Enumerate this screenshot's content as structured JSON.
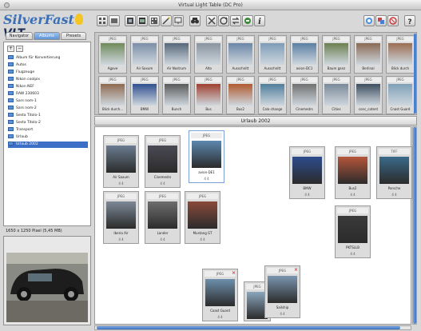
{
  "window": {
    "title": "Virtual Light Table (DC Pro)"
  },
  "logo": {
    "silver": "SilverFast",
    "vlt": "VLT"
  },
  "toolbar": {
    "left": [
      "grid-view-icon",
      "preview-icon",
      "film-icon",
      "filmstrip-icon",
      "contact-sheet-icon",
      "magic-wand-icon",
      "display-icon",
      "binoculars-icon",
      "delete-icon",
      "rotate-icon",
      "transfer-icon",
      "export-icon",
      "info-icon"
    ],
    "right": [
      "scan-icon",
      "convert-icon",
      "close-circle-icon",
      "help-icon"
    ],
    "info_label": "i",
    "help_label": "?"
  },
  "tabs": [
    "Navigator",
    "Albums",
    "Presets"
  ],
  "tree": {
    "items": [
      "Album für Konvertierung",
      "Autos",
      "Flugzeuge",
      "Nikon coolpix",
      "Nikon NEF",
      "RAW 230603",
      "Sars nom-1",
      "Sars nom-2",
      "Sesta Titolo-1",
      "Sesta Titolo-2",
      "Transport",
      "Urlaub",
      "Urlaub 2002"
    ],
    "selected_index": 12,
    "add_label": "+",
    "remove_label": "−"
  },
  "image_info": "1650 x 1250 Pixel (5,45 MB)",
  "top_strip": [
    {
      "tag": "JPEG",
      "label": "Agave",
      "color": "#6f8a5a"
    },
    {
      "tag": "JPEG",
      "label": "Air Saxum",
      "color": "#7b8fa8"
    },
    {
      "tag": "JPEG",
      "label": "Air Nostrum",
      "color": "#55677a"
    },
    {
      "tag": "JPEG",
      "label": "Alto",
      "color": "#8894a0"
    },
    {
      "tag": "JPEG",
      "label": "Ausschnitt",
      "color": "#6a86a6"
    },
    {
      "tag": "JPEG",
      "label": "Ausschnitt",
      "color": "#7e9cb8"
    },
    {
      "tag": "JPEG",
      "label": "avion-DC1",
      "color": "#5a7fa3"
    },
    {
      "tag": "JPEG",
      "label": "Baum ganz",
      "color": "#6b8050"
    },
    {
      "tag": "JPEG",
      "label": "Berlinal",
      "color": "#8a6a55"
    },
    {
      "tag": "JPEG",
      "label": "Blick durch",
      "color": "#9a6d52"
    },
    {
      "tag": "JPEG",
      "label": "Blick durch...",
      "color": "#8f6a4f"
    },
    {
      "tag": "JPEG",
      "label": "BMW",
      "color": "#2f4f8f"
    },
    {
      "tag": "JPEG",
      "label": "Bunch",
      "color": "#5a5a5a"
    },
    {
      "tag": "JPEG",
      "label": "Bus",
      "color": "#a04030"
    },
    {
      "tag": "JPEG",
      "label": "Bus2",
      "color": "#b05a30"
    },
    {
      "tag": "JPEG",
      "label": "Cala change",
      "color": "#4f7e9c"
    },
    {
      "tag": "JPEG",
      "label": "Cinemedrs",
      "color": "#707070"
    },
    {
      "tag": "JPEG",
      "label": "Cities",
      "color": "#7a8a9a"
    },
    {
      "tag": "JPEG",
      "label": "conc_cotent",
      "color": "#3e4f60"
    },
    {
      "tag": "JPEG",
      "label": "Cnast Guard",
      "color": "#7fa0b8"
    }
  ],
  "album_title": "Urlaub 2002",
  "light_table": [
    {
      "tag": "JPEG",
      "label": "Air Saxum",
      "status": "4 4",
      "color": "#6a7c90"
    },
    {
      "tag": "JPEG",
      "label": "Cinemedrs",
      "status": "4 4",
      "color": "#4a4a55"
    },
    {
      "tag": "JPEG",
      "label": "avion-DE1",
      "status": "4 4",
      "color": "#5d88b0"
    },
    {
      "tag": "JPEG",
      "label": "BMW",
      "status": "4 4",
      "color": "#2d4c8c"
    },
    {
      "tag": "JPEG",
      "label": "Bus2",
      "status": "4 4",
      "color": "#b5563a"
    },
    {
      "tag": "TIFF",
      "label": "Porsche",
      "status": "4 4",
      "color": "#3a6a8a"
    },
    {
      "tag": "JPEG",
      "label": "Iberia Air",
      "status": "4 4",
      "color": "#7c8896"
    },
    {
      "tag": "JPEG",
      "label": "Lander",
      "status": "4 4",
      "color": "#6e6e6e"
    },
    {
      "tag": "JPEG",
      "label": "Mustang GT",
      "status": "4 4",
      "color": "#8a4a3a"
    },
    {
      "tag": "JPEG",
      "label": "PKTSLLB",
      "status": "4 4",
      "color": "#3a3a3a"
    },
    {
      "tag": "JPEG",
      "label": "Coast Guard",
      "status": "4 4",
      "color": "#6d8fac"
    },
    {
      "tag": "JPEG",
      "label": "",
      "status": "",
      "color": "#8aa5bd"
    },
    {
      "tag": "JPEG",
      "label": "Sailship",
      "status": "4 4",
      "color": "#7a95b0"
    }
  ],
  "close_label": "×"
}
